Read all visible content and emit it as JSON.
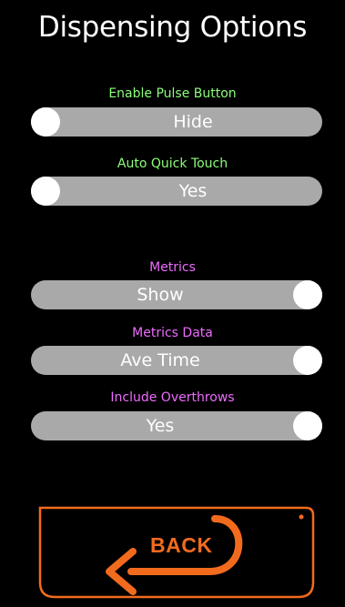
{
  "page": {
    "title": "Dispensing Options"
  },
  "options": [
    {
      "label": "Enable Pulse Button",
      "label_color": "#8cff7a",
      "value": "Hide",
      "switch_state": "off"
    },
    {
      "label": "Auto Quick Touch",
      "label_color": "#8cff7a",
      "value": "Yes",
      "switch_state": "off"
    },
    {
      "label": "Metrics",
      "label_color": "#ee6cff",
      "value": "Show",
      "switch_state": "on"
    },
    {
      "label": "Metrics Data",
      "label_color": "#ee6cff",
      "value": "Ave Time",
      "switch_state": "on"
    },
    {
      "label": "Include Overthrows",
      "label_color": "#ee6cff",
      "value": "Yes",
      "switch_state": "on"
    }
  ],
  "back": {
    "label": "BACK",
    "icon": "back-arrow-icon",
    "color": "#f26b1d"
  },
  "colors": {
    "background": "#000000",
    "toggle_track": "#a9a9a9",
    "toggle_knob": "#ffffff"
  }
}
